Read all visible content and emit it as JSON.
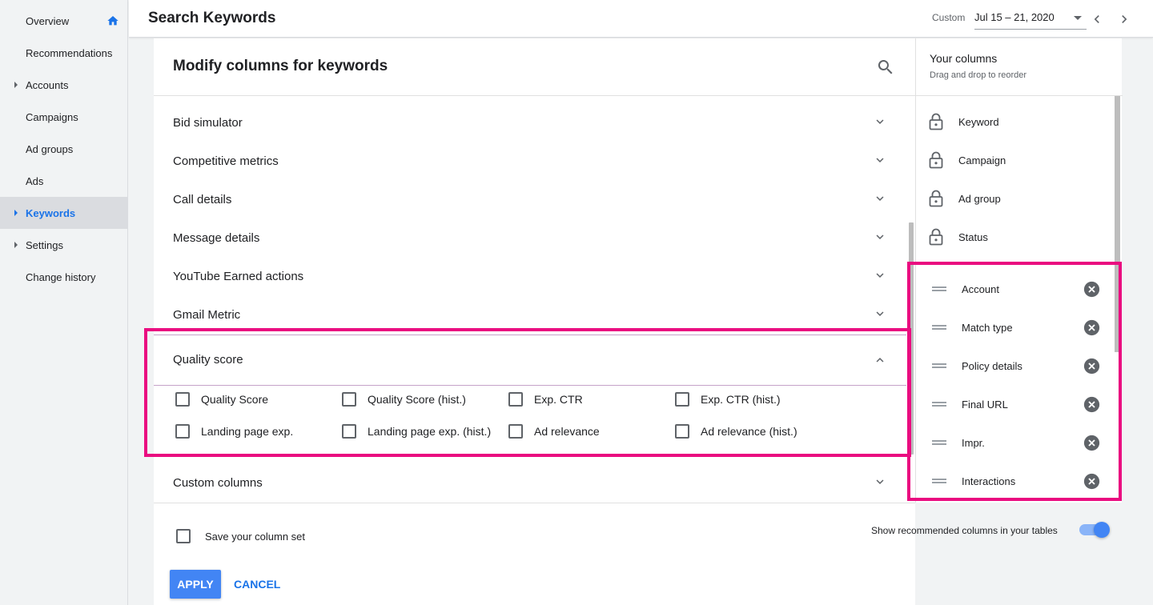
{
  "sidebar": {
    "items": [
      {
        "label": "Overview"
      },
      {
        "label": "Recommendations"
      },
      {
        "label": "Accounts"
      },
      {
        "label": "Campaigns"
      },
      {
        "label": "Ad groups"
      },
      {
        "label": "Ads"
      },
      {
        "label": "Keywords"
      },
      {
        "label": "Settings"
      },
      {
        "label": "Change history"
      }
    ]
  },
  "header": {
    "title": "Search Keywords",
    "date_label": "Custom",
    "date_range": "Jul 15 – 21, 2020"
  },
  "panel": {
    "title": "Modify columns for keywords",
    "sections": [
      {
        "label": "Bid simulator"
      },
      {
        "label": "Competitive metrics"
      },
      {
        "label": "Call details"
      },
      {
        "label": "Message details"
      },
      {
        "label": "YouTube Earned actions"
      },
      {
        "label": "Gmail Metric"
      }
    ],
    "quality_score": {
      "label": "Quality score",
      "options": [
        {
          "label": "Quality Score",
          "checked": false
        },
        {
          "label": "Quality Score (hist.)",
          "checked": false
        },
        {
          "label": "Exp. CTR",
          "checked": false
        },
        {
          "label": "Exp. CTR (hist.)",
          "checked": false
        },
        {
          "label": "Landing page exp.",
          "checked": false
        },
        {
          "label": "Landing page exp. (hist.)",
          "checked": false
        },
        {
          "label": "Ad relevance",
          "checked": false
        },
        {
          "label": "Ad relevance (hist.)",
          "checked": false
        }
      ]
    },
    "custom_columns": {
      "label": "Custom columns"
    }
  },
  "footer": {
    "save_label": "Save your column set",
    "toggle_label": "Show recommended columns in your tables",
    "toggle_on": true,
    "apply_label": "APPLY",
    "cancel_label": "CANCEL"
  },
  "your_columns": {
    "title": "Your columns",
    "subtitle": "Drag and drop to reorder",
    "fixed": [
      {
        "label": "Keyword"
      },
      {
        "label": "Campaign"
      },
      {
        "label": "Ad group"
      },
      {
        "label": "Status"
      }
    ],
    "movable": [
      {
        "label": "Account"
      },
      {
        "label": "Match type"
      },
      {
        "label": "Policy details"
      },
      {
        "label": "Final URL"
      },
      {
        "label": "Impr."
      },
      {
        "label": "Interactions"
      }
    ]
  },
  "colors": {
    "accent": "#1a73e8",
    "primary_button": "#4285f4",
    "highlight": "#ea0c80",
    "icon_gray": "#5f6368"
  },
  "icons": {
    "home": "home-icon",
    "search": "search-icon",
    "chevron_down": "chevron-down-icon",
    "chevron_up": "chevron-up-icon",
    "lock": "lock-icon",
    "drag": "drag-handle-icon",
    "remove": "remove-icon"
  }
}
